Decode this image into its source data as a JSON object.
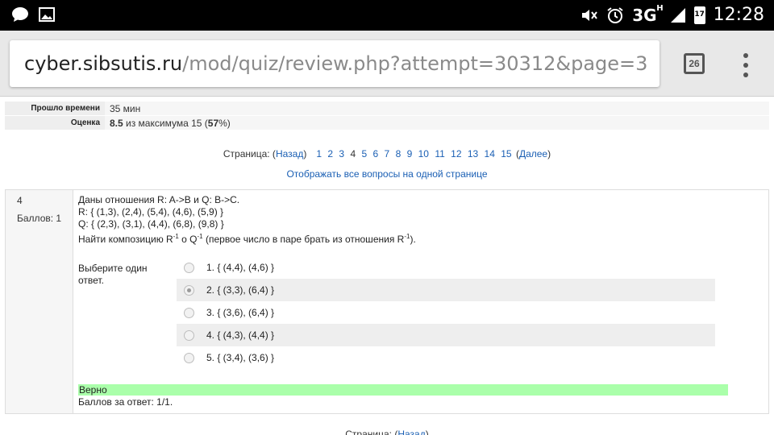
{
  "status_bar": {
    "network": "3G",
    "network_sup": "H",
    "battery": "17",
    "time": "12:28"
  },
  "browser": {
    "url_host": "cyber.sibsutis.ru",
    "url_path": "/mod/quiz/review.php?attempt=30312&page=3",
    "tab_count": "26"
  },
  "summary": {
    "rows": [
      {
        "label": "Прошло времени",
        "value": "35 мин"
      },
      {
        "label": "Оценка",
        "value_bold": "8.5",
        "value_mid": " из максимума 15 (",
        "value_pct": "57",
        "value_end": "%)"
      }
    ]
  },
  "pager": {
    "prefix": "Страница: (",
    "prev": "Назад",
    "mid": ")",
    "pages": [
      "1",
      "2",
      "3",
      "4",
      "5",
      "6",
      "7",
      "8",
      "9",
      "10",
      "11",
      "12",
      "13",
      "14",
      "15"
    ],
    "current": "4",
    "open": "(",
    "next": "Далее",
    "close": ")",
    "show_all": "Отображать все вопросы на одной странице"
  },
  "question": {
    "number": "4",
    "mark": "Баллов: 1",
    "line1": "Даны отношения R: A->B  и  Q: B->C.",
    "line2": "R: { (1,3), (2,4), (5,4), (4,6), (5,9) }",
    "line3": "Q: { (2,3), (3,1), (4,4), (6,8), (9,8) }",
    "line4_a": "Найти композицию R",
    "sup1": "-1",
    "line4_b": " o Q",
    "sup2": "-1",
    "line4_c": " (первое число в паре брать из отношения R",
    "sup3": "-1",
    "line4_d": ").",
    "prompt": "Выберите один ответ.",
    "answers": [
      {
        "label": "1. { (4,4), (4,6) }",
        "checked": false
      },
      {
        "label": "2. { (3,3), (6,4) }",
        "checked": true
      },
      {
        "label": "3. { (3,6), (6,4) }",
        "checked": false
      },
      {
        "label": "4. { (4,3), (4,4) }",
        "checked": false
      },
      {
        "label": "5. { (3,4), (3,6) }",
        "checked": false
      }
    ],
    "feedback": "Верно",
    "grade": "Баллов за ответ: 1/1."
  }
}
